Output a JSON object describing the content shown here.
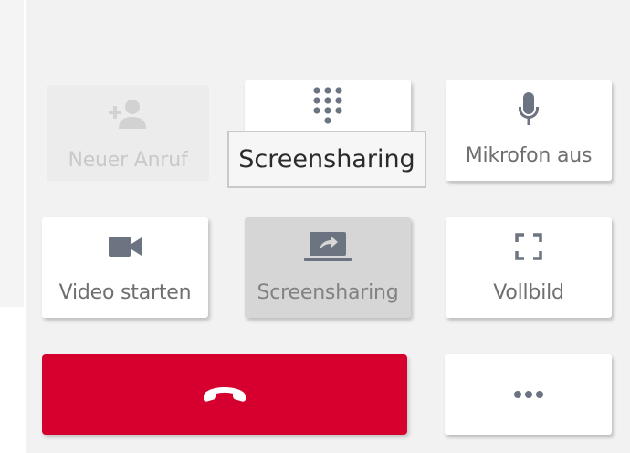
{
  "colors": {
    "hangup_red": "#d5002e",
    "icon_gray": "#6b7480",
    "disabled_gray": "#c9c9c9"
  },
  "tooltip": {
    "text": "Screensharing"
  },
  "buttons": {
    "new_call": {
      "label": "Neuer Anruf",
      "icon": "add-person-icon",
      "state": "disabled"
    },
    "dialpad": {
      "label": "",
      "icon": "dialpad-icon"
    },
    "mute": {
      "label": "Mikrofon aus",
      "icon": "microphone-icon"
    },
    "video": {
      "label": "Video starten",
      "icon": "video-camera-icon"
    },
    "screenshare": {
      "label": "Screensharing",
      "icon": "screen-share-icon",
      "state": "active"
    },
    "fullscreen": {
      "label": "Vollbild",
      "icon": "fullscreen-icon"
    },
    "hangup": {
      "icon": "phone-hangup-icon"
    },
    "more": {
      "icon": "more-dots-icon"
    }
  }
}
